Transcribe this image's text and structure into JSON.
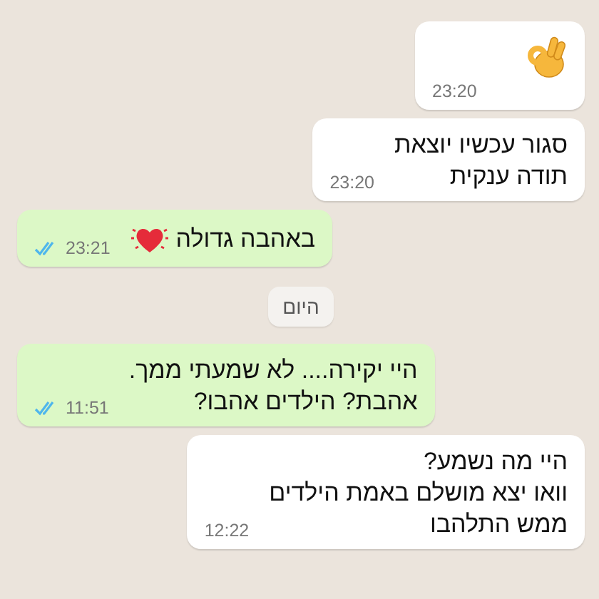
{
  "messages": [
    {
      "kind": "received",
      "emoji_only": true,
      "time": "23:20"
    },
    {
      "kind": "received",
      "text": "סגור עכשיו יוצאת\nתודה ענקית",
      "time": "23:20"
    },
    {
      "kind": "sent",
      "text": "באהבה גדולה",
      "trailing_emoji": true,
      "time": "23:21",
      "read": true
    },
    {
      "kind": "date",
      "text": "היום"
    },
    {
      "kind": "sent",
      "text": "היי יקירה.... לא שמעתי ממך.\nאהבת? הילדים אהבו?",
      "time": "11:51",
      "read": true
    },
    {
      "kind": "received",
      "text": "היי מה נשמע?\nוואו יצא מושלם באמת הילדים\nממש התלהבו",
      "time": "12:22"
    }
  ]
}
